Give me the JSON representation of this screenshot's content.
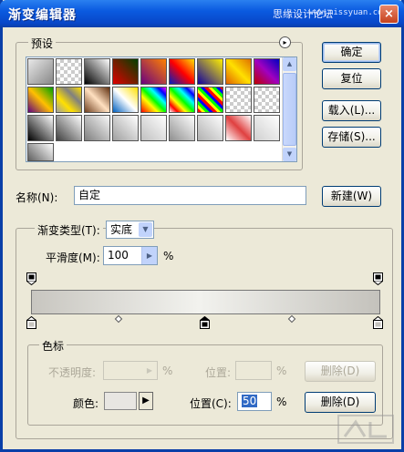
{
  "window": {
    "title": "渐变编辑器",
    "watermark": "思缘设计论坛",
    "watermark_url": "www.missyuan.com",
    "close": "×"
  },
  "presets": {
    "legend": "预设",
    "menu_arrow": "▸"
  },
  "buttons": {
    "ok": "确定",
    "reset": "复位",
    "load": "载入(L)...",
    "save": "存储(S)...",
    "new": "新建(W)"
  },
  "name": {
    "label": "名称(N):",
    "value": "自定"
  },
  "gradient": {
    "type_label": "渐变类型(T):",
    "type_value": "实底",
    "smooth_label": "平滑度(M):",
    "smooth_value": "100",
    "smooth_unit": "%"
  },
  "stops": {
    "legend": "色标",
    "opacity_label": "不透明度:",
    "opacity_unit": "%",
    "opacity_position_label": "位置:",
    "opacity_position_unit": "%",
    "delete_opacity": "删除(D)",
    "color_label": "颜色:",
    "color_position_label": "位置(C):",
    "color_position_value": "50",
    "color_position_unit": "%",
    "delete_color": "删除(D)"
  },
  "colors": {
    "title_bar": "#0a5ae0",
    "accent": "#0a3fa8"
  }
}
